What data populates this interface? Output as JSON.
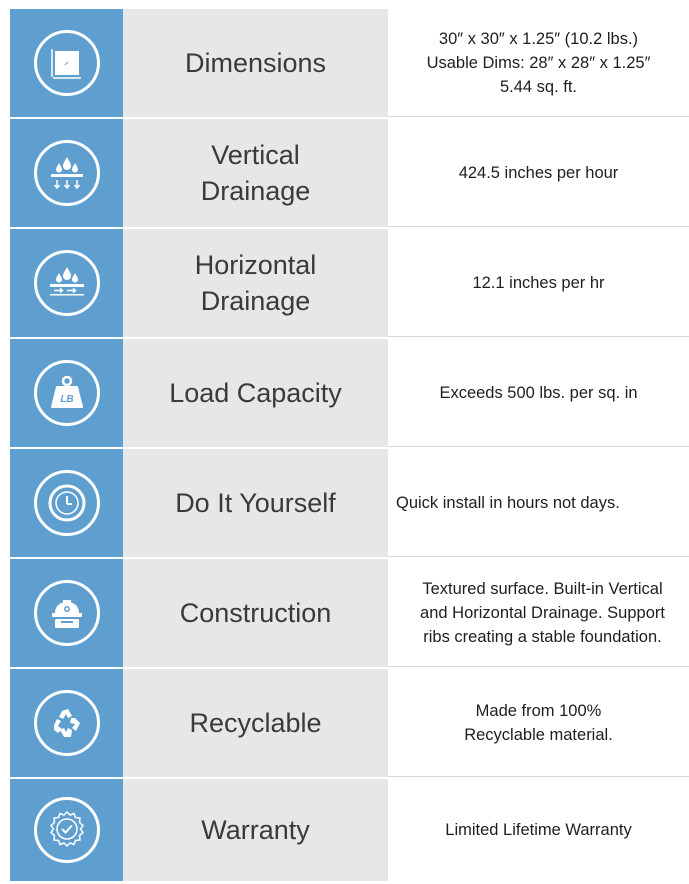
{
  "rows": [
    {
      "icon": "square-dimensions-icon",
      "label_lines": [
        "Dimensions"
      ],
      "value_lines": [
        "30″ x 30″ x 1.25″ (10.2 lbs.)",
        "Usable Dims: 28″ x 28″ x 1.25″",
        "5.44 sq. ft."
      ]
    },
    {
      "icon": "vertical-drainage-icon",
      "label_lines": [
        "Vertical",
        "Drainage"
      ],
      "value_lines": [
        "424.5 inches per hour"
      ]
    },
    {
      "icon": "horizontal-drainage-icon",
      "label_lines": [
        "Horizontal",
        "Drainage"
      ],
      "value_lines": [
        "12.1 inches per hr"
      ]
    },
    {
      "icon": "weight-lb-icon",
      "icon_text": "LB",
      "label_lines": [
        "Load Capacity"
      ],
      "value_lines": [
        "Exceeds 500 lbs. per sq. in"
      ]
    },
    {
      "icon": "clock-icon",
      "label_lines": [
        "Do It Yourself"
      ],
      "value_lines": [
        "Quick install in hours not days."
      ]
    },
    {
      "icon": "construction-hardhat-icon",
      "label_lines": [
        "Construction"
      ],
      "value_lines": [
        "Textured surface. Built-in Vertical",
        "and Horizontal Drainage. Support",
        "ribs creating a stable foundation."
      ]
    },
    {
      "icon": "recycle-icon",
      "label_lines": [
        "Recyclable"
      ],
      "value_lines": [
        "Made from 100%",
        "Recyclable material."
      ]
    },
    {
      "icon": "warranty-badge-icon",
      "label_lines": [
        "Warranty"
      ],
      "value_lines": [
        "Limited Lifetime Warranty"
      ]
    }
  ],
  "colors": {
    "icon_bg": "#5f9fd0",
    "label_bg": "#e6e7e8",
    "text": "#1e1e1e"
  }
}
